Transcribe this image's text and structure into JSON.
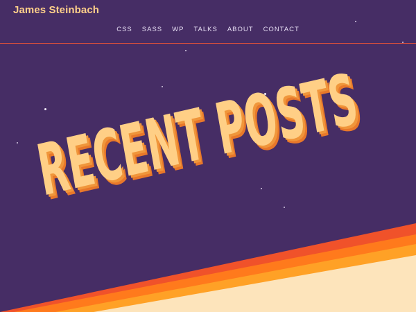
{
  "header": {
    "site_title": "James Steinbach",
    "nav": [
      {
        "label": "CSS"
      },
      {
        "label": "SASS"
      },
      {
        "label": "WP"
      },
      {
        "label": "TALKS"
      },
      {
        "label": "ABOUT"
      },
      {
        "label": "CONTACT"
      }
    ]
  },
  "hero": {
    "headline": "RECENT POSTS"
  },
  "colors": {
    "background": "#462d65",
    "title": "#ffd08a",
    "headline_fill": "#ffcf86",
    "headline_shadow": "#e8782a",
    "stripe_red": "#f0522a",
    "stripe_orange": "#ff7a1c",
    "stripe_amber": "#ffa126",
    "stripe_cream": "#fde4bb"
  }
}
